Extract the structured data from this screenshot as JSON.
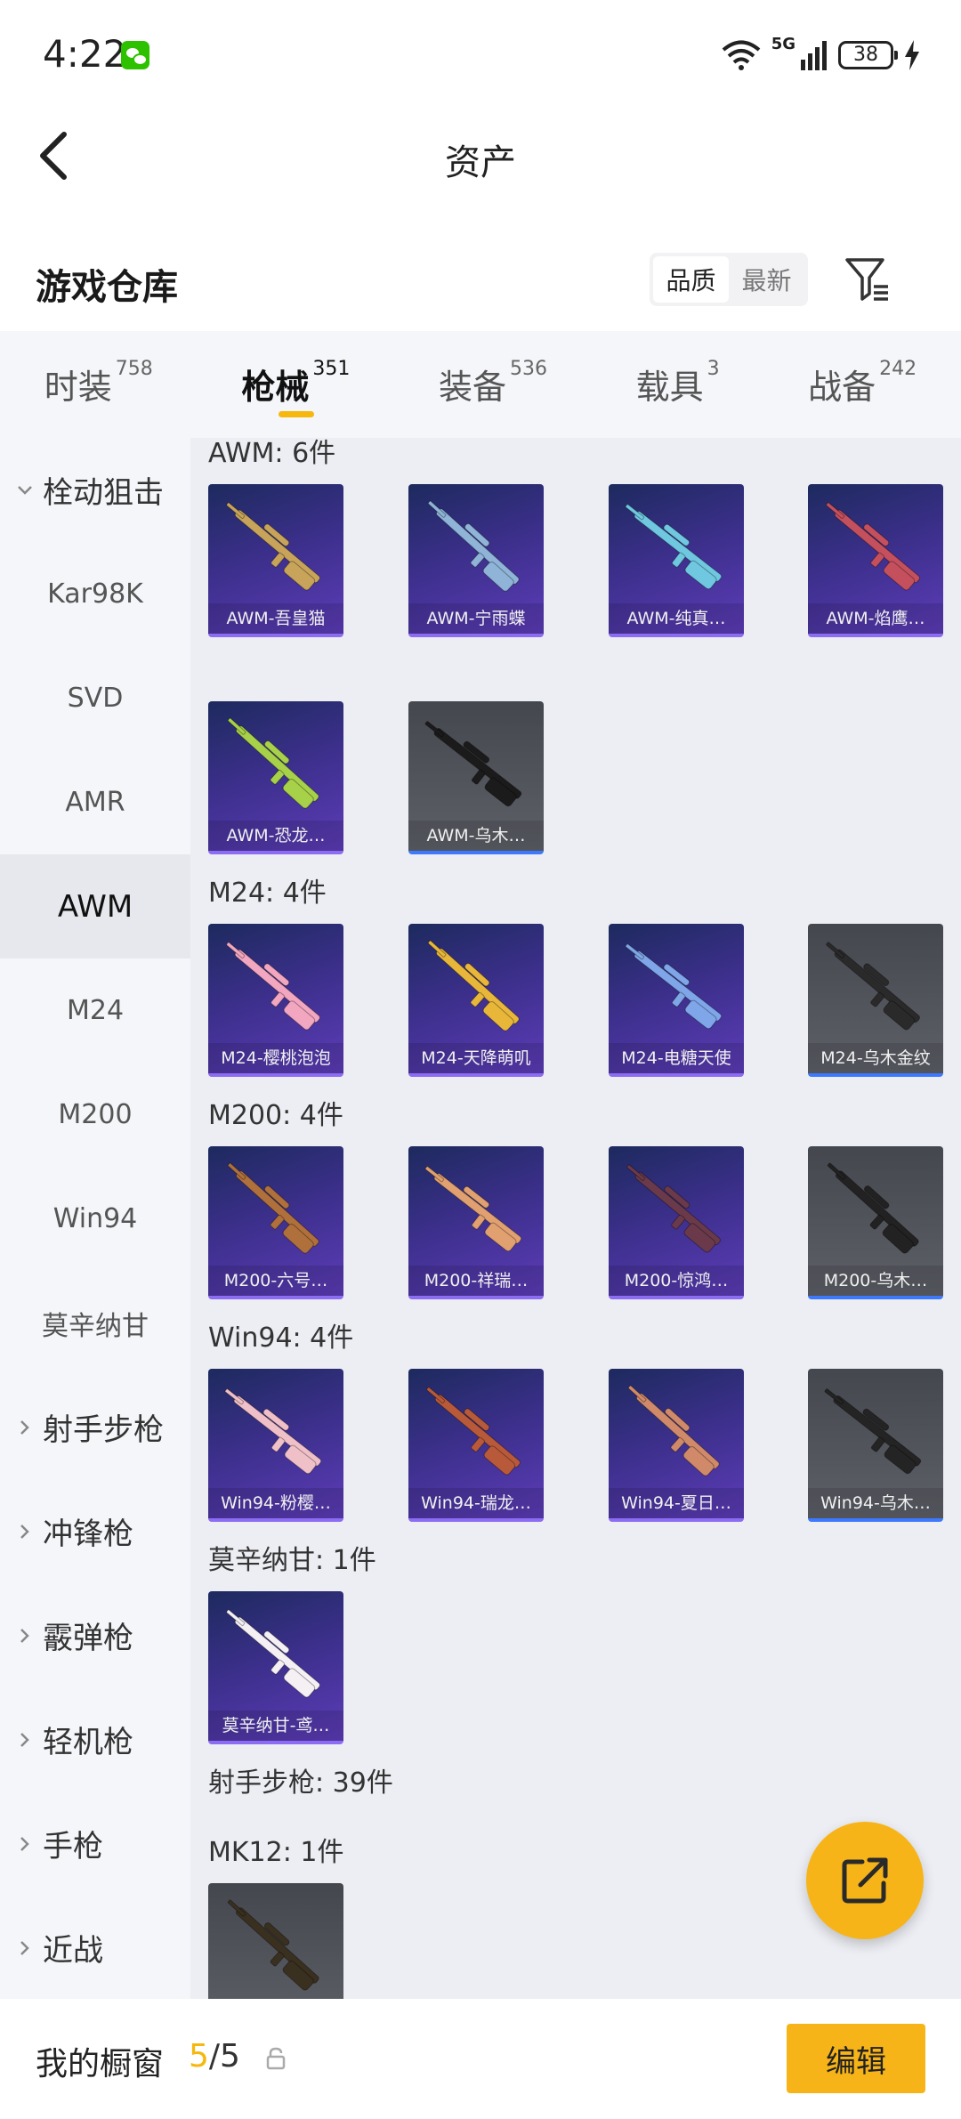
{
  "status_bar": {
    "time": "4:22",
    "network": "5G",
    "battery": "38"
  },
  "title_bar": {
    "title": "资产"
  },
  "warehouse": {
    "title": "游戏仓库",
    "sort_options": [
      "品质",
      "最新"
    ],
    "active_sort": "品质"
  },
  "tabs": [
    {
      "label": "时装",
      "count": "758"
    },
    {
      "label": "枪械",
      "count": "351",
      "active": true
    },
    {
      "label": "装备",
      "count": "536"
    },
    {
      "label": "载具",
      "count": "3"
    },
    {
      "label": "战备",
      "count": "242"
    }
  ],
  "sidebar": {
    "items": [
      {
        "label": "栓动狙击",
        "type": "group",
        "expanded": true
      },
      {
        "label": "Kar98K",
        "type": "sub"
      },
      {
        "label": "SVD",
        "type": "sub"
      },
      {
        "label": "AMR",
        "type": "sub"
      },
      {
        "label": "AWM",
        "type": "sub",
        "active": true
      },
      {
        "label": "M24",
        "type": "sub"
      },
      {
        "label": "M200",
        "type": "sub"
      },
      {
        "label": "Win94",
        "type": "sub"
      },
      {
        "label": "莫辛纳甘",
        "type": "sub"
      },
      {
        "label": "射手步枪",
        "type": "group"
      },
      {
        "label": "冲锋枪",
        "type": "group"
      },
      {
        "label": "霰弹枪",
        "type": "group"
      },
      {
        "label": "轻机枪",
        "type": "group"
      },
      {
        "label": "手枪",
        "type": "group"
      },
      {
        "label": "近战",
        "type": "group"
      }
    ]
  },
  "sections": [
    {
      "heading": "AWM: 6件",
      "items": [
        {
          "name": "AWM-吾皇猫",
          "style": "purple"
        },
        {
          "name": "AWM-宁雨蝶",
          "style": "purple"
        },
        {
          "name": "AWM-纯真…",
          "style": "purple"
        },
        {
          "name": "AWM-焰鹰…",
          "style": "purple"
        },
        {
          "name": "AWM-恐龙…",
          "style": "purple"
        },
        {
          "name": "AWM-乌木…",
          "style": "gray"
        }
      ]
    },
    {
      "heading": "M24: 4件",
      "items": [
        {
          "name": "M24-樱桃泡泡",
          "style": "purple"
        },
        {
          "name": "M24-天降萌叽",
          "style": "purple"
        },
        {
          "name": "M24-电糖天使",
          "style": "purple"
        },
        {
          "name": "M24-乌木金纹",
          "style": "gray"
        }
      ]
    },
    {
      "heading": "M200: 4件",
      "items": [
        {
          "name": "M200-六号…",
          "style": "purple"
        },
        {
          "name": "M200-祥瑞…",
          "style": "purple"
        },
        {
          "name": "M200-惊鸿…",
          "style": "purple"
        },
        {
          "name": "M200-乌木…",
          "style": "gray"
        }
      ]
    },
    {
      "heading": "Win94: 4件",
      "items": [
        {
          "name": "Win94-粉樱…",
          "style": "purple"
        },
        {
          "name": "Win94-瑞龙…",
          "style": "purple"
        },
        {
          "name": "Win94-夏日…",
          "style": "purple"
        },
        {
          "name": "Win94-乌木…",
          "style": "gray"
        }
      ]
    },
    {
      "heading": "莫辛纳甘: 1件",
      "items": [
        {
          "name": "莫辛纳甘-鸢…",
          "style": "purple"
        }
      ]
    },
    {
      "heading": "射手步枪: 39件",
      "items": []
    },
    {
      "heading": "MK12: 1件",
      "items": [
        {
          "name": "",
          "style": "gray"
        }
      ]
    }
  ],
  "gun_colors": [
    "#c7a45a",
    "#8fb4d8",
    "#6fc8e0",
    "#c4505e",
    "#a8d14a",
    "#1b1b1b",
    "#f2a6c0",
    "#e8b73a",
    "#7fa6e8",
    "#2a2a2a",
    "#b0703c",
    "#e0a070",
    "#6a3a4a",
    "#222222",
    "#f0c0c8",
    "#b85a3a",
    "#d08a6a",
    "#242424",
    "#f4f0f4",
    "#3a3020"
  ],
  "bottom_bar": {
    "label": "我的橱窗",
    "current": "5",
    "total": "/5",
    "edit_label": "编辑"
  },
  "colors": {
    "accent": "#f6b80d",
    "purple_card": "#3b2f8a",
    "gray_card": "#55575f"
  }
}
